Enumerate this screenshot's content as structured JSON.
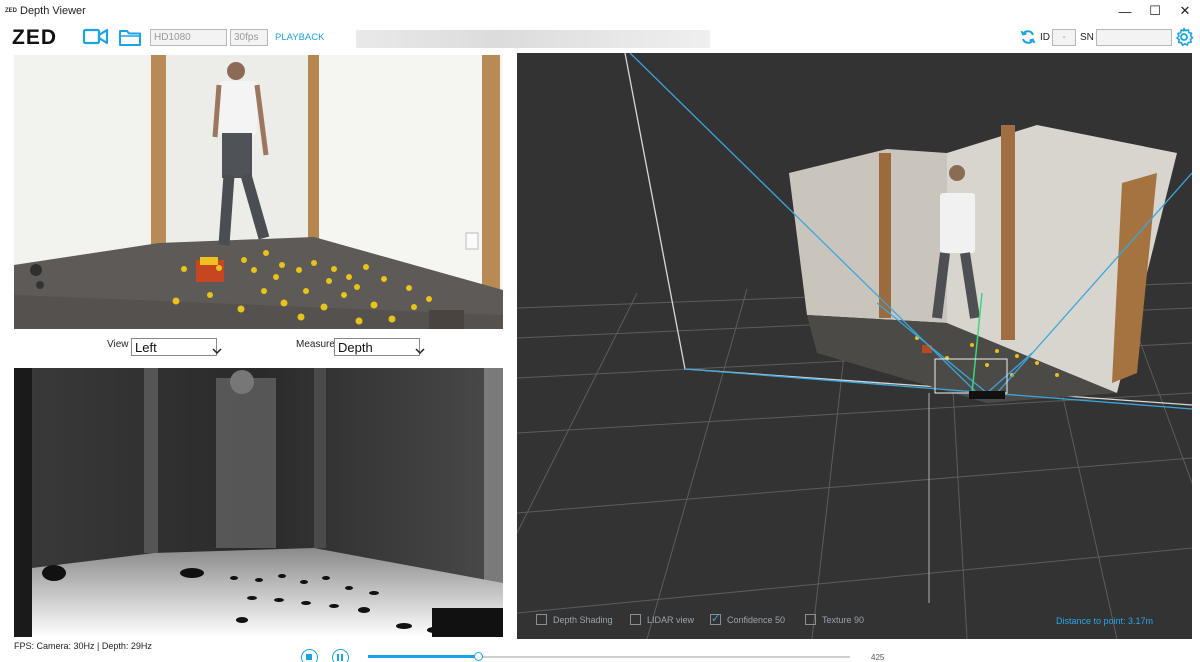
{
  "window": {
    "logo_text": "ZED",
    "title": "Depth Viewer",
    "minimize": "—",
    "maximize": "☐",
    "close": "✕"
  },
  "toolbar": {
    "logo": "ZED",
    "camera_icon": "video-camera-icon",
    "folder_icon": "folder-icon",
    "resolution": "HD1080",
    "fps": "30fps",
    "playback": "PLAYBACK",
    "refresh_icon": "refresh-icon",
    "id_label": "ID",
    "id_value": "-",
    "sn_label": "SN",
    "settings_icon": "gear-icon",
    "accent_color": "#1aa3e6"
  },
  "view_selector": {
    "label": "View",
    "value": "Left"
  },
  "measure_selector": {
    "label": "Measure",
    "value": "Depth"
  },
  "view3d_options": {
    "items": [
      {
        "label": "Depth Shading",
        "checked": false
      },
      {
        "label": "LIDAR view",
        "checked": false
      },
      {
        "label": "Confidence 50",
        "checked": true
      },
      {
        "label": "Texture 90",
        "checked": false
      }
    ],
    "distance": "Distance to point: 3.17m"
  },
  "status": {
    "fps_text": "FPS: Camera: 30Hz | Depth: 29Hz"
  },
  "playback_controls": {
    "stop_icon": "stop-icon",
    "pause_icon": "pause-icon",
    "progress": 0.23,
    "frame": "425"
  }
}
